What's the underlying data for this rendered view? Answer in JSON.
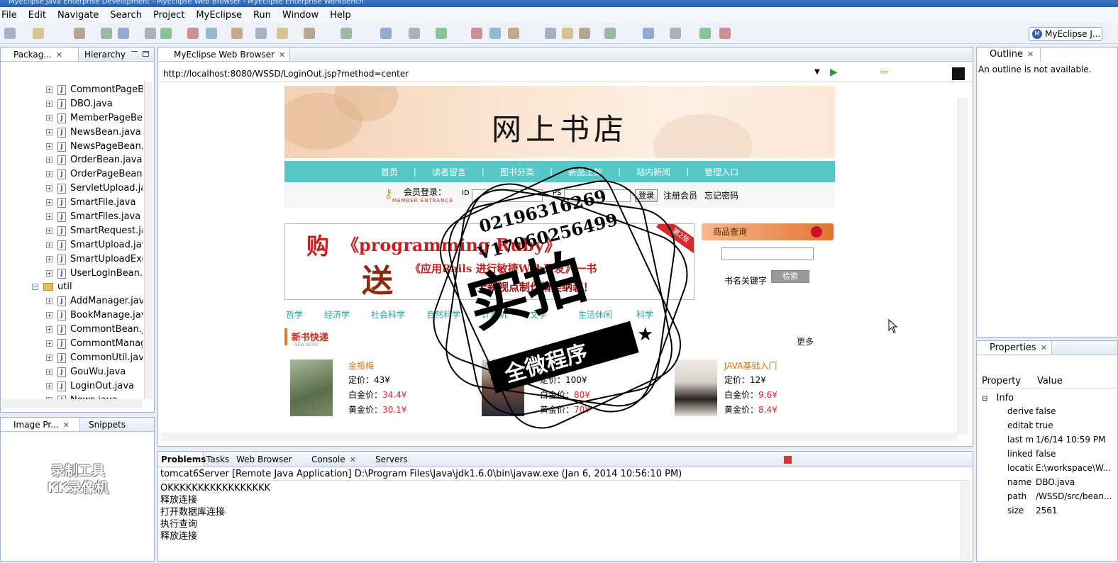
{
  "window": {
    "title": "MyEclipse Java Enterprise Development - MyEclipse Web Browser - MyEclipse Enterprise Workbench"
  },
  "menu": [
    "File",
    "Edit",
    "Navigate",
    "Search",
    "Project",
    "MyEclipse",
    "Run",
    "Window",
    "Help"
  ],
  "perspective": {
    "label": "MyEclipse J...",
    "badge": "M"
  },
  "package_view": {
    "tabs": [
      "Packag...",
      "Hierarchy"
    ],
    "items": [
      {
        "label": "CommontPageBe",
        "type": "java"
      },
      {
        "label": "DBO.java",
        "type": "java"
      },
      {
        "label": "MemberPageBea",
        "type": "java"
      },
      {
        "label": "NewsBean.java",
        "type": "java"
      },
      {
        "label": "NewsPageBean.ja",
        "type": "java"
      },
      {
        "label": "OrderBean.java",
        "type": "java"
      },
      {
        "label": "OrderPageBean.ja",
        "type": "java"
      },
      {
        "label": "ServletUpload.jav",
        "type": "java"
      },
      {
        "label": "SmartFile.java",
        "type": "java"
      },
      {
        "label": "SmartFiles.java",
        "type": "java"
      },
      {
        "label": "SmartRequest.java",
        "type": "java"
      },
      {
        "label": "SmartUpload.java",
        "type": "java"
      },
      {
        "label": "SmartUploadExce",
        "type": "java"
      },
      {
        "label": "UserLoginBean.ja",
        "type": "java"
      },
      {
        "label": "util",
        "type": "package"
      },
      {
        "label": "AddManager.java",
        "type": "java"
      },
      {
        "label": "BookManage.java",
        "type": "java"
      },
      {
        "label": "CommontBean.jav",
        "type": "java"
      },
      {
        "label": "CommontManage",
        "type": "java"
      },
      {
        "label": "CommonUtil.java",
        "type": "java"
      },
      {
        "label": "GouWu.java",
        "type": "java"
      },
      {
        "label": "LoginOut.java",
        "type": "java"
      },
      {
        "label": "News.java",
        "type": "java"
      }
    ],
    "java_glyph": "J",
    "expand_glyph": "+",
    "collapse_glyph": "−"
  },
  "image_view": {
    "tabs": [
      "Image Pr...",
      "Snippets"
    ]
  },
  "browser": {
    "tab": "MyEclipse Web Browser",
    "url": "http://localhost:8080/WSSD/LoginOut.jsp?method=center"
  },
  "site": {
    "store_title": "网上书店",
    "nav": [
      "首页",
      "读者留言",
      "图书分类",
      "新品上架",
      "站内新闻",
      "管理入口"
    ],
    "login": {
      "label": "会员登录：",
      "sub": "MEMBER ENTRANCE",
      "id_label": "ID",
      "ps_label": "PS",
      "login_btn": "登录",
      "register": "注册会员",
      "forgot": "忘记密码"
    },
    "promo": {
      "buy": "购",
      "gift": "送",
      "line1": "《programming Ruby》",
      "line2": "《应用Rails 进行敏捷Web开发》一书",
      "line3": "全新视点制作精美纳装！",
      "ribbon": "第2版"
    },
    "search": {
      "head": "商品查询",
      "keyword_label": "书名关键字",
      "btn": "检索"
    },
    "categories": [
      "哲学",
      "经济学",
      "社会科学",
      "自然科学",
      "计算机",
      "文学",
      "生活休闲",
      "科学"
    ],
    "new_books": {
      "title": "新书快递",
      "sub": "NEW BOOK",
      "more": "更多"
    },
    "books": [
      {
        "title": "金瓶梅",
        "price": "定价：43¥",
        "gold": "白金价：",
        "gold_v": "34.4¥",
        "plat": "黄金价：",
        "plat_v": "30.1¥"
      },
      {
        "title": "",
        "price": "定价：100¥",
        "gold": "白金价：",
        "gold_v": "80¥",
        "plat": "黄金价：",
        "plat_v": "70¥"
      },
      {
        "title": "JAVA基础入门",
        "price": "定价：12¥",
        "gold": "白金价：",
        "gold_v": "9.6¥",
        "plat": "黄金价：",
        "plat_v": "8.4¥"
      }
    ]
  },
  "stamp": {
    "phone": "02196316269",
    "qq": "V17060256499",
    "main": "实拍",
    "banner": "全微程序"
  },
  "outline": {
    "tab": "Outline",
    "message": "An outline is not available."
  },
  "properties": {
    "tab": "Properties",
    "col_property": "Property",
    "col_value": "Value",
    "group": "Info",
    "rows": [
      {
        "k": "derive",
        "v": "false"
      },
      {
        "k": "editab",
        "v": "true"
      },
      {
        "k": "last m",
        "v": "1/6/14 10:59 PM"
      },
      {
        "k": "linked",
        "v": "false"
      },
      {
        "k": "locatic",
        "v": "E:\\workspace\\W..."
      },
      {
        "k": "name",
        "v": "DBO.java"
      },
      {
        "k": "path",
        "v": "/WSSD/src/bean..."
      },
      {
        "k": "size",
        "v": "2561"
      }
    ]
  },
  "bottom": {
    "tabs": [
      "Problems",
      "Tasks",
      "Web Browser",
      "Console",
      "Servers"
    ],
    "server_line": "tomcat6Server [Remote Java Application] D:\\Program Files\\Java\\jdk1.6.0\\bin\\javaw.exe (Jan 6, 2014 10:56:10 PM)",
    "lines": [
      "OKKKKKKKKKKKKKKKKK",
      "释放连接",
      "打开数据库连接",
      "执行查询",
      "释放连接"
    ]
  },
  "recorder_watermark": [
    "录制工具",
    "KK录像机"
  ],
  "colors": {
    "accent": "#57c7c8",
    "brand": "#2e5fa8",
    "price_red": "#dd2222"
  }
}
